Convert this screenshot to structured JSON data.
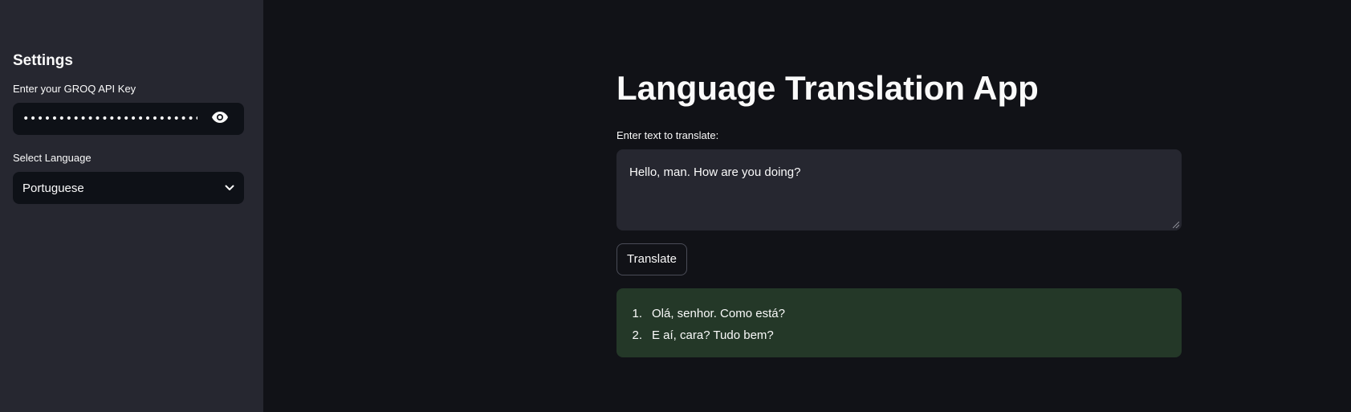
{
  "sidebar": {
    "title": "Settings",
    "api_key": {
      "label": "Enter your GROQ API Key",
      "value": "••••••••••••••••••••••••••••••••••••••••••••••••••••••",
      "toggle_icon": "eye-icon"
    },
    "language": {
      "label": "Select Language",
      "selected": "Portuguese",
      "dropdown_icon": "chevron-down-icon"
    }
  },
  "main": {
    "title": "Language Translation App",
    "input": {
      "label": "Enter text to translate:",
      "value": "Hello, man. How are you doing?"
    },
    "translate_button": "Translate",
    "result": {
      "background_color": "#243828",
      "items": [
        {
          "number": "1.",
          "text": "Olá, senhor. Como está?"
        },
        {
          "number": "2.",
          "text": "E aí, cara? Tudo bem?"
        }
      ]
    }
  },
  "colors": {
    "background": "#111217",
    "sidebar": "#262730",
    "input": "#0e1117",
    "text": "#fafafa",
    "success": "#243828"
  }
}
